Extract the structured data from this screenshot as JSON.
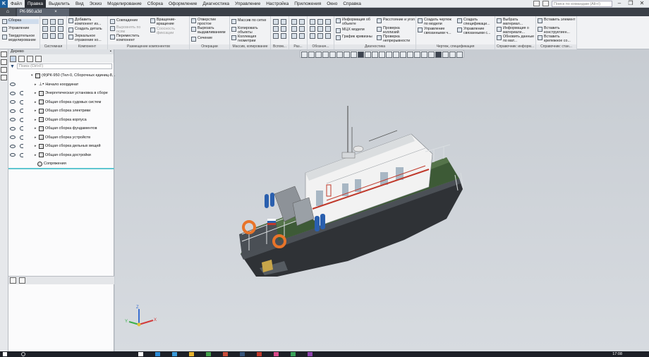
{
  "menu": {
    "items": [
      "Файл",
      "Правка",
      "Выделить",
      "Вид",
      "Эскиз",
      "Моделирование",
      "Сборка",
      "Оформление",
      "Диагностика",
      "Управление",
      "Настройка",
      "Приложения",
      "Окно",
      "Справка"
    ],
    "active_index": 1,
    "command_search_placeholder": "Поиск по командам (Alt+/)"
  },
  "tabs": {
    "document": "РК-950.a3d",
    "close": "×"
  },
  "ribbon": {
    "modes": [
      "Сборка",
      "Управление",
      "Твердотельное моделирование"
    ],
    "groups": {
      "system": "Системная",
      "component": "Компонент",
      "placement": "Размещение компонентов",
      "operations": "Операции",
      "array": "Массив, копирование",
      "aux": "Вспом...",
      "dims": "Раз...",
      "markup": "Обознач...",
      "diagnostics": "Диагностика",
      "drawing_spec": "Чертеж, спецификация",
      "reference_info": "Справочник: информ...",
      "reference_std": "Справочник: стан..."
    },
    "buttons": {
      "add_component": "Добавить компонент из...",
      "create_part": "Создать деталь",
      "mirror_component": "Зеркальное отражение ко...",
      "coincidence": "Совпадение",
      "align_axes": "Выровнять по осям",
      "move_component": "Переместить компонент",
      "rotation": "Вращение-вращение",
      "fixed_mate": "Соосность фиксации",
      "hole": "Отверстие простое",
      "cut_extrude": "Вырезать выдавливанием",
      "section": "Сечение",
      "array_by_grid": "Массив по сетке",
      "copy_objects": "Копировать объекты",
      "geometry_collection": "Коллекция геометрии",
      "object_info": "Информация об объекте",
      "mcc_model": "МЦХ модели",
      "curvature_graph": "График кривизны",
      "distance_angle": "Расстояние и угол",
      "check_collisions": "Проверка коллизий",
      "check_continuity": "Проверка непрерывности",
      "create_drawing": "Создать чертеж по модели",
      "manage_linked": "Управление связанными ч...",
      "create_spec": "Создать спецификаци...",
      "manage_linked_spec": "Управление связанными с...",
      "choose_material": "Выбрать материал...",
      "material_info": "Информация о материале...",
      "update_material": "Обновить данные по мат...",
      "insert_element": "Вставить элемент",
      "insert_structure": "Вставить конструктиен...",
      "insert_fastener": "Вставить крепежное со..."
    }
  },
  "tree_panel": {
    "title": "Дерево",
    "search_placeholder": "Поиск (Ctrl+F)",
    "nodes": [
      {
        "label": "(Ф)РК-950 (Тел-0, Сборочных единиц-8, ...",
        "level": 0
      },
      {
        "label": "Начало координат",
        "level": 1
      },
      {
        "label": "Энергетическая установка в сборе",
        "level": 1
      },
      {
        "label": "Общая сборка судовых систем",
        "level": 1
      },
      {
        "label": "Общая сборка электрики",
        "level": 1
      },
      {
        "label": "Общая сборка корпуса",
        "level": 1
      },
      {
        "label": "Общая сборка фундаментов",
        "level": 1
      },
      {
        "label": "Общая сборка устройств",
        "level": 1
      },
      {
        "label": "Общая сборка дельных вещей",
        "level": 1
      },
      {
        "label": "Общая сборка достройки",
        "level": 1
      },
      {
        "label": "Сопряжения",
        "level": 1
      }
    ]
  },
  "viewport": {
    "axes": {
      "x": "X",
      "y": "Y",
      "z": "Z"
    },
    "colors": {
      "hull": "#2f3236",
      "deck": "#3d5a36",
      "cabin": "#f2f2f2",
      "stripe": "#c0392b",
      "buoy": "#e8742a"
    }
  },
  "taskbar": {
    "clock": "17:08"
  }
}
